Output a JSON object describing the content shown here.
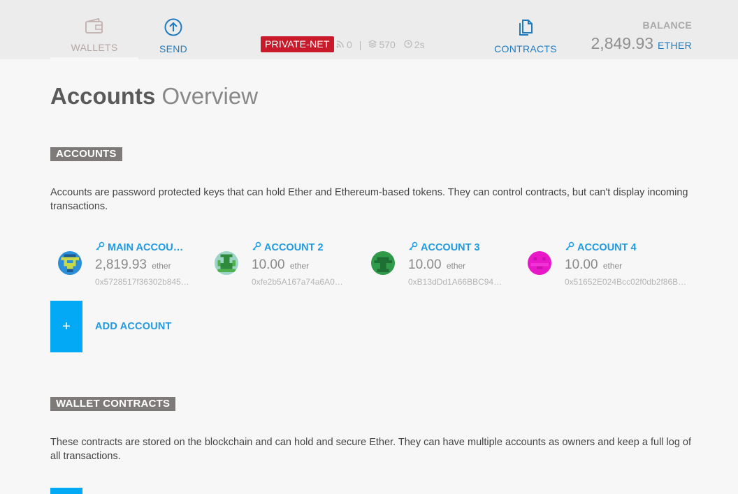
{
  "header": {
    "nav": {
      "wallets_label": "WALLETS",
      "send_label": "SEND",
      "contracts_label": "CONTRACTS"
    },
    "network_badge": "PRIVATE-NET",
    "peers": "0",
    "block_number": "570",
    "last_block_time": "2s",
    "balance_title": "BALANCE",
    "balance_value": "2,849.93",
    "balance_unit": "ETHER"
  },
  "page_title": {
    "strong": "Accounts",
    "light": "Overview"
  },
  "accounts_section": {
    "tag": "ACCOUNTS",
    "description": "Accounts are password protected keys that can hold Ether and Ethereum-based tokens. They can control contracts, but can't display incoming transactions.",
    "items": [
      {
        "name": "MAIN ACCOU…",
        "balance": "2,819.93",
        "unit": "ether",
        "address": "0x5728517f36302b845…"
      },
      {
        "name": "ACCOUNT 2",
        "balance": "10.00",
        "unit": "ether",
        "address": "0xfe2b5A167a74a6A0…"
      },
      {
        "name": "ACCOUNT 3",
        "balance": "10.00",
        "unit": "ether",
        "address": "0xB13dDd1A66BBC94…"
      },
      {
        "name": "ACCOUNT 4",
        "balance": "10.00",
        "unit": "ether",
        "address": "0x51652E024Bcc02f0db2f86B…"
      }
    ],
    "add_symbol": "+",
    "add_label": "ADD ACCOUNT"
  },
  "wallet_contracts_section": {
    "tag": "WALLET CONTRACTS",
    "description": "These contracts are stored on the blockchain and can hold and secure Ether. They can have multiple accounts as owners and keep a full log of all transactions."
  },
  "colors": {
    "accent": "#1f7bbf",
    "link": "#1f9ae0",
    "button": "#03a9f4",
    "network_badge": "#c81a2a",
    "section_tag": "#7f7a7a"
  },
  "icons": [
    "wallet-icon",
    "send-arrow-icon",
    "contracts-icon",
    "peers-icon",
    "blocks-icon",
    "clock-icon",
    "key-icon",
    "identicon"
  ]
}
